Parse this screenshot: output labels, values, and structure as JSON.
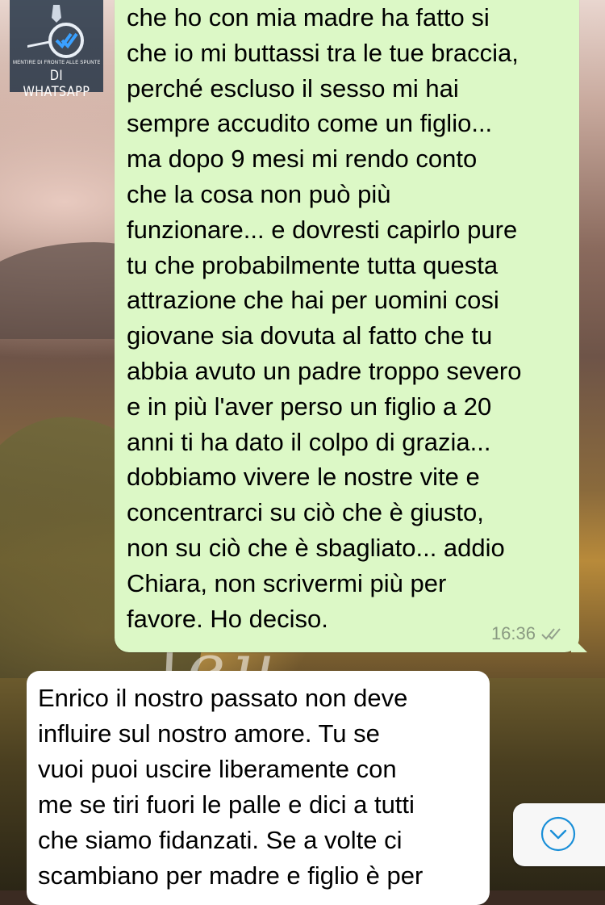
{
  "watermark": {
    "small_text": "MENTIRE DI FRONTE ALLE SPUNTE BLU",
    "big_text": "DI WHATSAPP"
  },
  "outgoing_message": {
    "text": "che ho con mia madre ha fatto si\nche io mi buttassi tra le tue braccia,\nperché escluso il sesso mi hai\nsempre accudito come un figlio...\nma dopo 9 mesi mi rendo conto\nche la cosa non può più\nfunzionare... e dovresti capirlo pure\ntu che probabilmente tutta questa\nattrazione che hai per uomini cosi\ngiovane sia dovuta al fatto che tu\nabbia avuto un padre troppo severo\ne in più l'aver perso un figlio a 20\nanni ti ha dato il colpo di grazia...\ndobbiamo vivere le nostre vite e\nconcentrarci su ciò che è giusto,\nnon su ciò che è sbagliato... addio\nChiara, non scrivermi più per\nfavore. Ho deciso.",
    "time": "16:36",
    "status_icon": "double-check-icon"
  },
  "incoming_message": {
    "text": "Enrico il nostro passato non deve\ninfluire sul nostro amore.  Tu se\nvuoi puoi uscire liberamente con\nme se tiri fuori le palle e dici a tutti\nche siamo fidanzati.  Se a volte ci\nscambiano per madre e figlio è per"
  },
  "scroll_button": {
    "icon": "chevron-down-icon"
  },
  "colors": {
    "outgoing_bubble": "#dcf8c6",
    "incoming_bubble": "#ffffff",
    "accent": "#1a8fd8"
  }
}
